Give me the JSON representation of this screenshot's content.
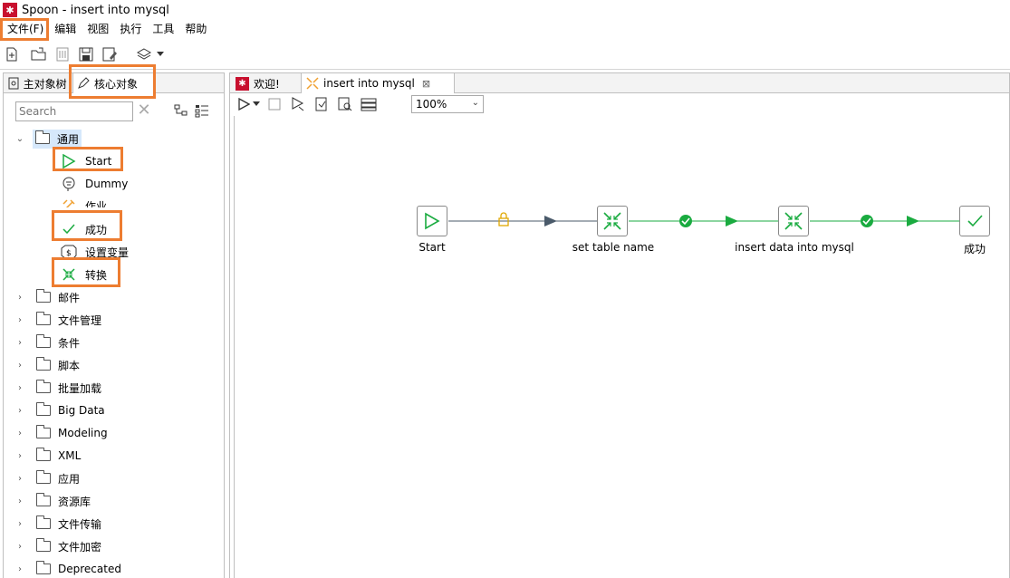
{
  "window": {
    "title": "Spoon - insert into mysql"
  },
  "menubar": [
    "文件(F)",
    "编辑",
    "视图",
    "执行",
    "工具",
    "帮助"
  ],
  "left_panel": {
    "tabs": [
      "主对象树",
      "核心对象"
    ],
    "search": {
      "placeholder": "Search"
    },
    "root_folder": "通用",
    "children": [
      "Start",
      "Dummy",
      "作业",
      "成功",
      "设置变量",
      "转换"
    ],
    "folders": [
      "邮件",
      "文件管理",
      "条件",
      "脚本",
      "批量加载",
      "Big Data",
      "Modeling",
      "XML",
      "应用",
      "资源库",
      "文件传输",
      "文件加密",
      "Deprecated"
    ]
  },
  "right_panel": {
    "tabs": [
      "欢迎!",
      "insert into mysql"
    ],
    "zoom": "100%",
    "nodes": [
      "Start",
      "set table name",
      "insert data into mysql",
      "成功"
    ]
  },
  "colors": {
    "highlight": "#ed7d31",
    "hop": "#1aab40",
    "lock": "#e0a800",
    "brand": "#c8102e"
  }
}
